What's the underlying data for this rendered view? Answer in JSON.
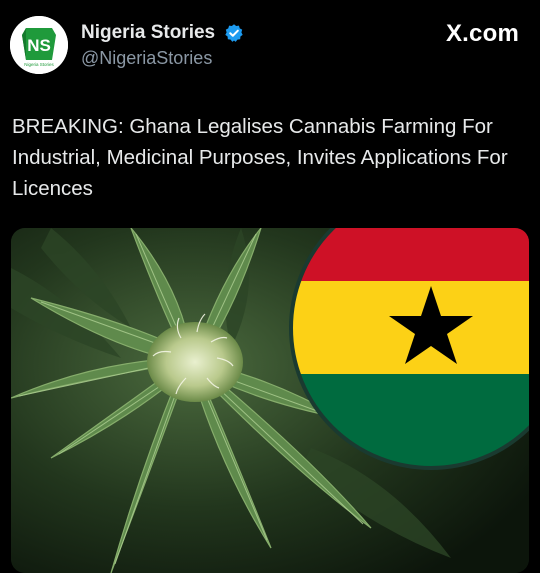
{
  "author": {
    "display_name": "Nigeria Stories",
    "handle": "@NigeriaStories",
    "avatar_letters": "NS",
    "avatar_caption": "Nigeria Stories",
    "verified_icon": "verified-badge-icon"
  },
  "platform": {
    "label": "X.com"
  },
  "post": {
    "text": "BREAKING: Ghana Legalises Cannabis Farming For Industrial, Medicinal Purposes, Invites Applications For Licences"
  },
  "media": {
    "description_icon": "cannabis-plant-with-ghana-flag",
    "flag_colors": {
      "red": "#ce1126",
      "gold": "#fcd116",
      "green": "#006b3f",
      "star": "#000000"
    }
  }
}
